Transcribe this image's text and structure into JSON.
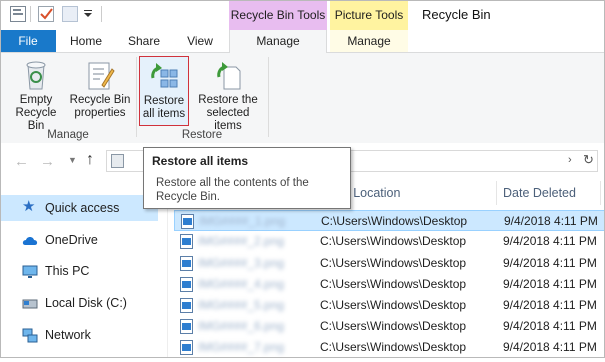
{
  "window": {
    "title": "Recycle Bin",
    "context_tabs": [
      {
        "label": "Recycle Bin Tools",
        "color": "#e8bdf0"
      },
      {
        "label": "Picture Tools",
        "color": "#fff3a0"
      }
    ]
  },
  "tabs": {
    "file": "File",
    "home": "Home",
    "share": "Share",
    "view": "View",
    "manage_recycle": "Manage",
    "manage_picture": "Manage"
  },
  "ribbon": {
    "manage_group": {
      "label": "Manage",
      "empty_bin": "Empty Recycle Bin",
      "properties": "Recycle Bin properties"
    },
    "restore_group": {
      "label": "Restore",
      "restore_all": "Restore all items",
      "restore_selected": "Restore the selected items"
    }
  },
  "tooltip": {
    "title": "Restore all items",
    "body": "Restore all the contents of the Recycle Bin."
  },
  "nav": [
    {
      "label": "Quick access",
      "icon": "star-icon",
      "selected": true
    },
    {
      "label": "OneDrive",
      "icon": "cloud-icon"
    },
    {
      "label": "This PC",
      "icon": "monitor-icon"
    },
    {
      "label": "Local Disk (C:)",
      "icon": "drive-icon"
    },
    {
      "label": "Network",
      "icon": "network-icon"
    }
  ],
  "columns": {
    "location": "al Location",
    "date": "Date Deleted"
  },
  "files": [
    {
      "name": "IMG####_1.png",
      "location": "C:\\Users\\Windows\\Desktop",
      "date": "9/4/2018 4:11 PM"
    },
    {
      "name": "IMG####_2.png",
      "location": "C:\\Users\\Windows\\Desktop",
      "date": "9/4/2018 4:11 PM"
    },
    {
      "name": "IMG####_3.png",
      "location": "C:\\Users\\Windows\\Desktop",
      "date": "9/4/2018 4:11 PM"
    },
    {
      "name": "IMG####_4.png",
      "location": "C:\\Users\\Windows\\Desktop",
      "date": "9/4/2018 4:11 PM"
    },
    {
      "name": "IMG####_5.png",
      "location": "C:\\Users\\Windows\\Desktop",
      "date": "9/4/2018 4:11 PM"
    },
    {
      "name": "IMG####_6.png",
      "location": "C:\\Users\\Windows\\Desktop",
      "date": "9/4/2018 4:11 PM"
    },
    {
      "name": "IMG####_7.png",
      "location": "C:\\Users\\Windows\\Desktop",
      "date": "9/4/2018 4:11 PM"
    },
    {
      "name": "IMG####_8.png",
      "location": "C:\\Users\\Windows\\Desktop",
      "date": "9/4/2018 4:11 PM"
    }
  ],
  "colors": {
    "file_tab": "#1979ca",
    "selection": "#cce8ff",
    "restore_highlight": "#d0323c"
  }
}
